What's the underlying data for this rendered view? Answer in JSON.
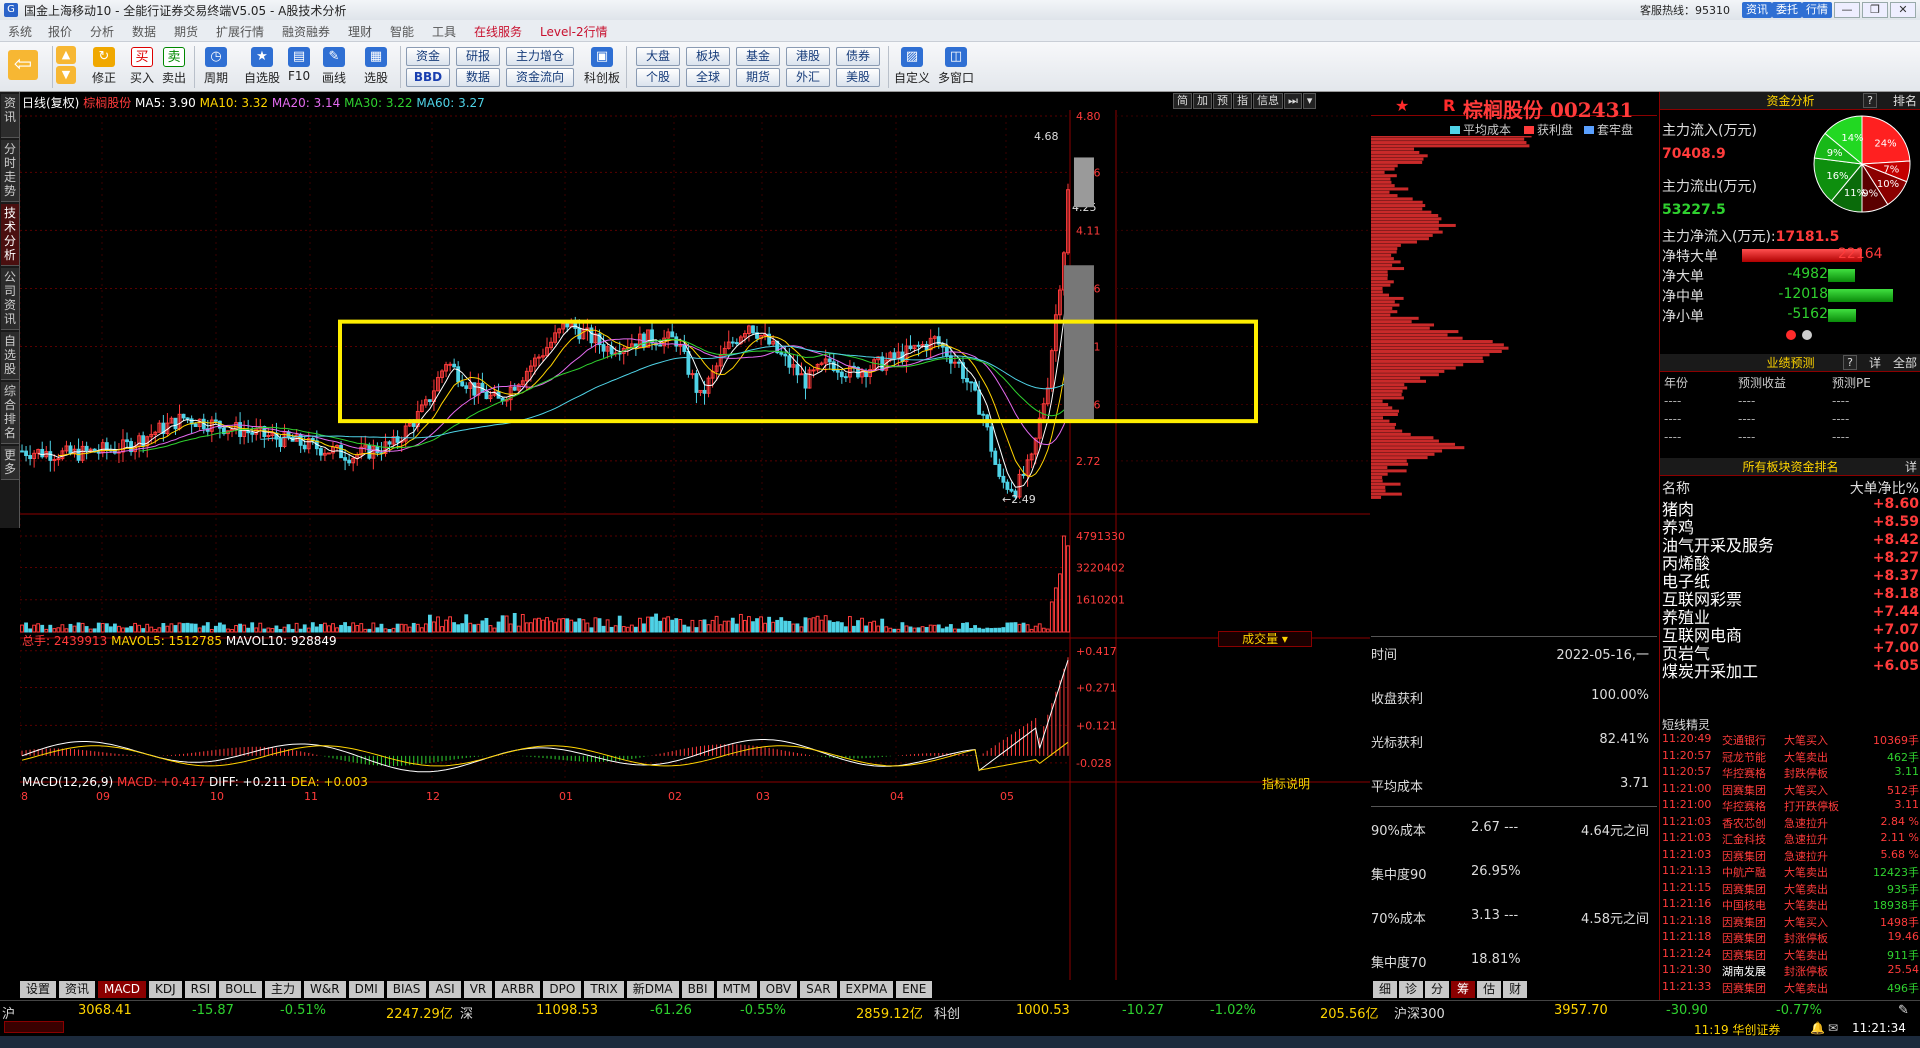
{
  "window": {
    "title": "国金上海移动10 - 全能行证券交易终端V5.05 - A股技术分析",
    "logo": "G",
    "hotline": "客服热线：95310",
    "quick_buttons": [
      "资讯",
      "委托",
      "行情"
    ],
    "window_buttons": [
      "—",
      "❐",
      "✕"
    ]
  },
  "menu": [
    "系统",
    "报价",
    "分析",
    "数据",
    "期货",
    "扩展行情",
    "融资融券",
    "理财",
    "智能",
    "工具",
    "在线服务",
    "Level-2行情"
  ],
  "toolbar": {
    "main": [
      {
        "label": "",
        "icon": "arrow-left-icon",
        "glyph": "⇦"
      },
      {
        "label": "修正",
        "icon": "refresh-icon",
        "glyph": "↻"
      },
      {
        "label": "买入",
        "icon": "buy-icon",
        "glyph": "买"
      },
      {
        "label": "卖出",
        "icon": "sell-icon",
        "glyph": "卖"
      },
      {
        "label": "周期",
        "icon": "clock-icon",
        "glyph": "◷"
      },
      {
        "label": "自选股",
        "icon": "star-icon",
        "glyph": "★"
      },
      {
        "label": "F10",
        "icon": "document-icon",
        "glyph": "▤"
      },
      {
        "label": "画线",
        "icon": "pencil-icon",
        "glyph": "✎"
      },
      {
        "label": "选股",
        "icon": "screen-icon",
        "glyph": "▦"
      }
    ],
    "small_groups": [
      [
        "资金",
        "BBD"
      ],
      [
        "研报",
        "数据"
      ],
      [
        "主力增仓",
        "资金流向"
      ],
      [
        "大盘",
        "个股"
      ],
      [
        "板块",
        "全球"
      ],
      [
        "基金",
        "期货"
      ],
      [
        "港股",
        "外汇"
      ],
      [
        "债券",
        "美股"
      ]
    ],
    "extra": [
      {
        "label": "科创板",
        "icon": "star-board-icon",
        "glyph": "▣"
      },
      {
        "label": "自定义",
        "icon": "custom-icon",
        "glyph": "▨"
      },
      {
        "label": "多窗口",
        "icon": "multiwindow-icon",
        "glyph": "◫"
      }
    ]
  },
  "left_tabs": [
    "资讯",
    "分时走势",
    "技术分析",
    "公司资讯",
    "自选股",
    "综合排名",
    "更多"
  ],
  "chart_header": {
    "period": "日线(复权)",
    "stock": "棕榈股份",
    "ma5": "MA5: 3.90",
    "ma10": "MA10: 3.32",
    "ma20": "MA20: 3.14",
    "ma30": "MA30: 3.22",
    "ma60": "MA60: 3.27"
  },
  "chart_tools": [
    "简",
    "加",
    "预",
    "指",
    "信息",
    "⏭",
    "▾"
  ],
  "price_axis": [
    "4.80",
    "4.46",
    "4.11",
    "3.76",
    "3.41",
    "3.06",
    "2.72"
  ],
  "price_marks": {
    "high": "4.68",
    "low": "2.49",
    "mid": "4.25"
  },
  "month_labels": [
    "08",
    "09",
    "10",
    "11",
    "12",
    "01",
    "02",
    "03",
    "04",
    "05"
  ],
  "volume_header": {
    "total": "总手: 2439913",
    "mavol5": "MAVOL5: 1512785",
    "mavol10": "MAVOL10: 928849",
    "menu": "成交量 ▾"
  },
  "volume_axis": [
    "4791330",
    "3220402",
    "1610201"
  ],
  "macd_header": {
    "label": "MACD(12,26,9)",
    "macd": "MACD: +0.417",
    "diff": "DIFF: +0.211",
    "dea": "DEA: +0.003",
    "help": "指标说明"
  },
  "macd_axis": [
    "+0.417",
    "+0.271",
    "+0.121",
    "-0.028"
  ],
  "indicator_tabs": [
    "设置",
    "资讯",
    "MACD",
    "KDJ",
    "RSI",
    "BOLL",
    "主力",
    "W&R",
    "DMI",
    "BIAS",
    "ASI",
    "VR",
    "ARBR",
    "DPO",
    "TRIX",
    "新DMA",
    "BBI",
    "MTM",
    "OBV",
    "SAR",
    "EXPMA",
    "ENE"
  ],
  "active_indicator": "MACD",
  "chip": {
    "flag": "R",
    "title": "棕榈股份 002431",
    "legend": [
      "平均成本",
      "获利盘",
      "套牢盘"
    ],
    "legend_colors": [
      "#4fd3e7",
      "#ff3b3b",
      "#5aa0ff"
    ],
    "time_label": "时间",
    "time_value": "2022-05-16,一",
    "profit_label": "收盘获利",
    "profit_value": "100.00%",
    "cursor_label": "光标获利",
    "cursor_value": "82.41%",
    "avg_label": "平均成本",
    "avg_value": "3.71",
    "c90_label": "90%成本",
    "c90_range": "2.67 ---",
    "c90_upper": "4.64元之间",
    "conc90_label": "集中度90",
    "conc90_value": "26.95%",
    "c70_label": "70%成本",
    "c70_range": "3.13 ---",
    "c70_upper": "4.58元之间",
    "conc70_label": "集中度70",
    "conc70_value": "18.81%",
    "tabs": [
      "细",
      "诊",
      "分",
      "筹",
      "估",
      "财"
    ],
    "active_tab": "筹"
  },
  "funds": {
    "header": "资金分析",
    "help": "?",
    "extra": "排名",
    "inflow_label": "主力流入(万元)",
    "inflow_value": "70408.9",
    "outflow_label": "主力流出(万元)",
    "outflow_value": "53227.5",
    "net_label": "主力净流入(万元):",
    "net_value": "17181.5",
    "pie": [
      {
        "label": "24%",
        "value": 24,
        "color": "#ff2020"
      },
      {
        "label": "7%",
        "value": 7,
        "color": "#c40000"
      },
      {
        "label": "10%",
        "value": 10,
        "color": "#8b0000"
      },
      {
        "label": "9%",
        "value": 9,
        "color": "#5a0000"
      },
      {
        "label": "11%",
        "value": 11,
        "color": "#0a6b0a"
      },
      {
        "label": "16%",
        "value": 16,
        "color": "#0e8f0e"
      },
      {
        "label": "9%",
        "value": 9,
        "color": "#18b818"
      },
      {
        "label": "14%",
        "value": 14,
        "color": "#22d822"
      }
    ],
    "nets": [
      {
        "label": "净特大单",
        "value": "22164",
        "amount": 22164
      },
      {
        "label": "净大单",
        "value": "-4982",
        "amount": -4982
      },
      {
        "label": "净中单",
        "value": "-12018",
        "amount": -12018
      },
      {
        "label": "净小单",
        "value": "-5162",
        "amount": -5162
      }
    ]
  },
  "forecast": {
    "header": "业绩预测",
    "help": "?",
    "detail": "详",
    "all": "全部",
    "columns": [
      "年份",
      "预测收益",
      "预测PE"
    ],
    "rows": [
      [
        "----",
        "----",
        "----"
      ],
      [
        "----",
        "----",
        "----"
      ],
      [
        "----",
        "----",
        "----"
      ]
    ]
  },
  "sectors": {
    "header": "所有板块资金排名",
    "detail": "详",
    "col_name": "名称",
    "col_value": "大单净比%",
    "rows": [
      {
        "name": "猪肉",
        "pct": "+8.60"
      },
      {
        "name": "养鸡",
        "pct": "+8.59"
      },
      {
        "name": "油气开采及服务",
        "pct": "+8.42"
      },
      {
        "name": "丙烯酸",
        "pct": "+8.27"
      },
      {
        "name": "电子纸",
        "pct": "+8.37"
      },
      {
        "name": "互联网彩票",
        "pct": "+8.18"
      },
      {
        "name": "养殖业",
        "pct": "+7.44"
      },
      {
        "name": "互联网电商",
        "pct": "+7.07"
      },
      {
        "name": "页岩气",
        "pct": "+7.00"
      },
      {
        "name": "煤炭开采加工",
        "pct": "+6.05"
      }
    ]
  },
  "shortline": {
    "header": "短线精灵",
    "events": [
      {
        "time": "11:20:49",
        "stock": "交通银行",
        "type": "大笔买入",
        "val": "10369手",
        "color": "#ff3b3b"
      },
      {
        "time": "11:20:57",
        "stock": "冠龙节能",
        "type": "大笔卖出",
        "val": "462手",
        "color": "#2fd12f"
      },
      {
        "time": "11:20:57",
        "stock": "华控赛格",
        "type": "封跌停板",
        "val": "3.11",
        "color": "#2fd12f"
      },
      {
        "time": "11:21:00",
        "stock": "因赛集团",
        "type": "大笔买入",
        "val": "512手",
        "color": "#ff3b3b"
      },
      {
        "time": "11:21:00",
        "stock": "华控赛格",
        "type": "打开跌停板",
        "val": "3.11",
        "color": "#ff3b3b"
      },
      {
        "time": "11:21:03",
        "stock": "香农芯创",
        "type": "急速拉升",
        "val": "2.84 %",
        "color": "#ff3b3b"
      },
      {
        "time": "11:21:03",
        "stock": "汇金科技",
        "type": "急速拉升",
        "val": "2.11 %",
        "color": "#ff3b3b"
      },
      {
        "time": "11:21:03",
        "stock": "因赛集团",
        "type": "急速拉升",
        "val": "5.68 %",
        "color": "#ff3b3b"
      },
      {
        "time": "11:21:13",
        "stock": "中航产融",
        "type": "大笔卖出",
        "val": "12423手",
        "color": "#2fd12f"
      },
      {
        "time": "11:21:15",
        "stock": "因赛集团",
        "type": "大笔卖出",
        "val": "935手",
        "color": "#2fd12f"
      },
      {
        "time": "11:21:16",
        "stock": "中国核电",
        "type": "大笔卖出",
        "val": "18938手",
        "color": "#2fd12f"
      },
      {
        "time": "11:21:18",
        "stock": "因赛集团",
        "type": "大笔买入",
        "val": "1498手",
        "color": "#ff3b3b"
      },
      {
        "time": "11:21:18",
        "stock": "因赛集团",
        "type": "封涨停板",
        "val": "19.46",
        "color": "#ff3b3b"
      },
      {
        "time": "11:21:24",
        "stock": "因赛集团",
        "type": "大笔卖出",
        "val": "911手",
        "color": "#2fd12f"
      },
      {
        "time": "11:21:30",
        "stock": "湖南发展",
        "type": "封涨停板",
        "val": "25.54",
        "color": "#ff3b3b"
      },
      {
        "time": "11:21:33",
        "stock": "因赛集团",
        "type": "大笔卖出",
        "val": "496手",
        "color": "#2fd12f"
      }
    ]
  },
  "status": {
    "sh_label": "沪",
    "sh_index": "3068.41",
    "sh_change": "-15.87",
    "sh_pct": "-0.51%",
    "sh_amount": "2247.29亿",
    "sz_label": "深",
    "sz_index": "11098.53",
    "sz_change": "-61.26",
    "sz_pct": "-0.55%",
    "sz_amount": "2859.12亿",
    "kc_label": "科创",
    "kc_index": "1000.53",
    "kc_change": "-10.27",
    "kc_pct": "-1.02%",
    "kc_amount": "205.56亿",
    "hs_label": "沪深300",
    "hs_index": "3957.70",
    "hs_change": "-30.90",
    "hs_pct": "-0.77%",
    "clock": "11:21:34",
    "ticker": "11:19 华创证券"
  },
  "chart_data": {
    "type": "candlestick",
    "price_range": [
      2.4,
      4.8
    ],
    "highlight_box": "yellow rectangle around 3.00–3.50 consolidation range",
    "last_close": 4.68,
    "period_high": 4.68,
    "period_low": 2.49
  }
}
